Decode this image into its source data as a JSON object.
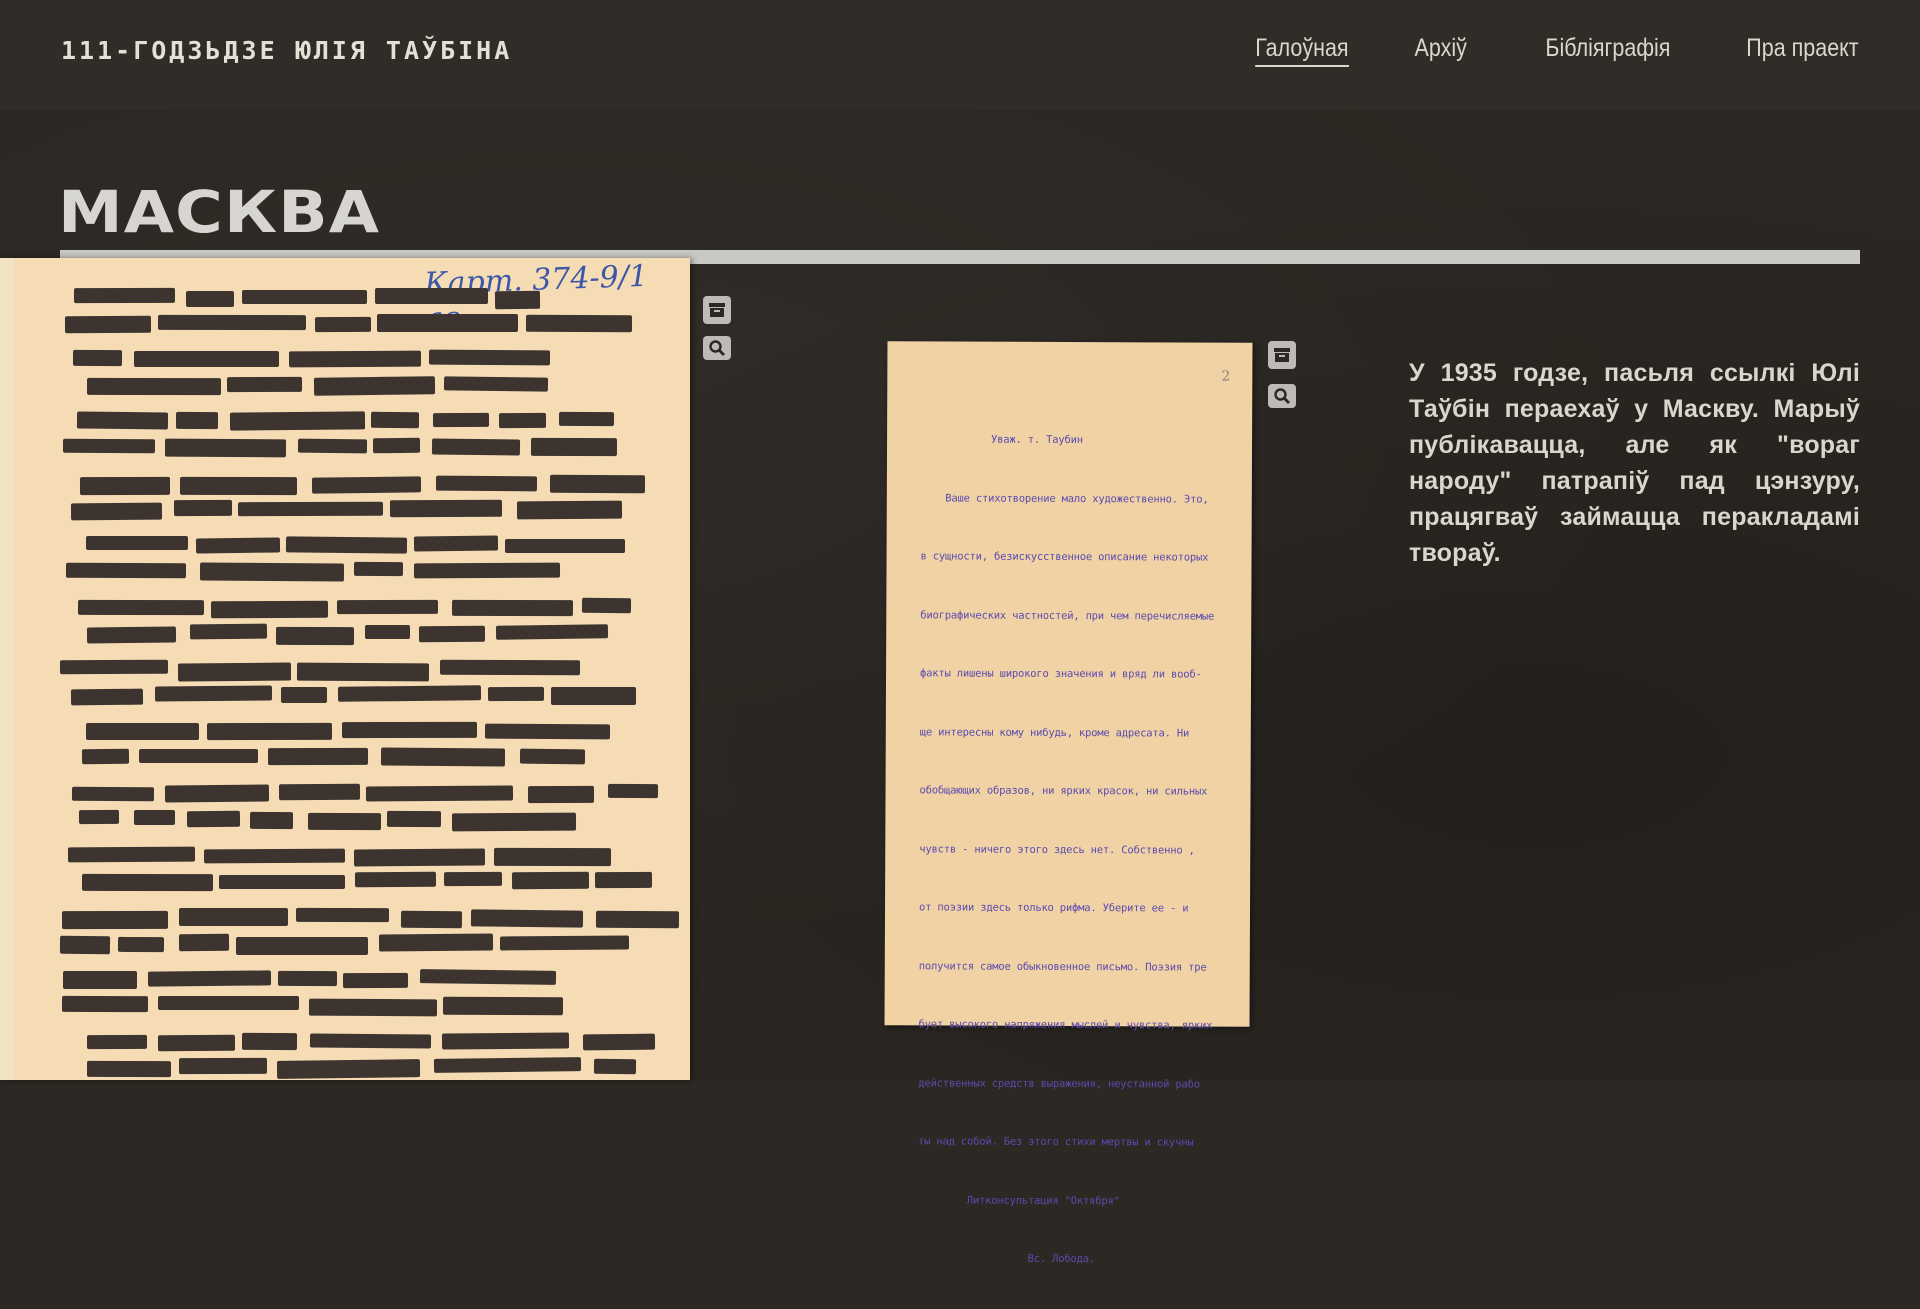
{
  "site": {
    "title": "111-годзьдзе юлія таўбіна"
  },
  "nav": {
    "items": [
      {
        "label": "Галоўная",
        "active": true
      },
      {
        "label": "Архіў",
        "active": false
      },
      {
        "label": "Бібліяграфія",
        "active": false
      },
      {
        "label": "Пра праект",
        "active": false
      }
    ]
  },
  "section": {
    "title": "МАСКВА"
  },
  "documents": [
    {
      "header_note": "Карт. 374-9/1 ав.",
      "icons": [
        "archive-icon",
        "search-icon"
      ],
      "redacted": true
    },
    {
      "page_number": "2",
      "icons": [
        "archive-icon",
        "search-icon"
      ],
      "text_lines": [
        "Уваж. т. Таубин",
        "    Ваше стихотворение мало художественно. Это,",
        "в сущности, безискусственное описание некоторых",
        "биографических частностей, при чем перечисляемые",
        "факты лишены широкого значения и вряд ли вооб-",
        "ще интересны кому нибудь, кроме адресата. Ни",
        "обобщающих образов, ни ярких красок, ни сильных",
        "чувств - ничего этого здесь нет. Собственно ,",
        "от поэзии здесь только рифма. Уберите ее - и",
        "получится самое обыкновенное письмо. Поэзия тре",
        "бует высокого напряжения мыслей и чувства, ярких",
        "действенных средств выражения, неустанной рабо",
        "ты над собой. Без этого стихи мертвы и скучны",
        "        Литконсультация \"Октября\"",
        "                  Вс. Лобода."
      ]
    }
  ],
  "description": "У 1935 годзе, пасьля ссылкі Юлі Таўбін пераехаў у Маскву. Марыў публікавацца, але як \"вораг народу\" патрапіў пад цэнзуру, працягваў займацца перакладамі твораў."
}
